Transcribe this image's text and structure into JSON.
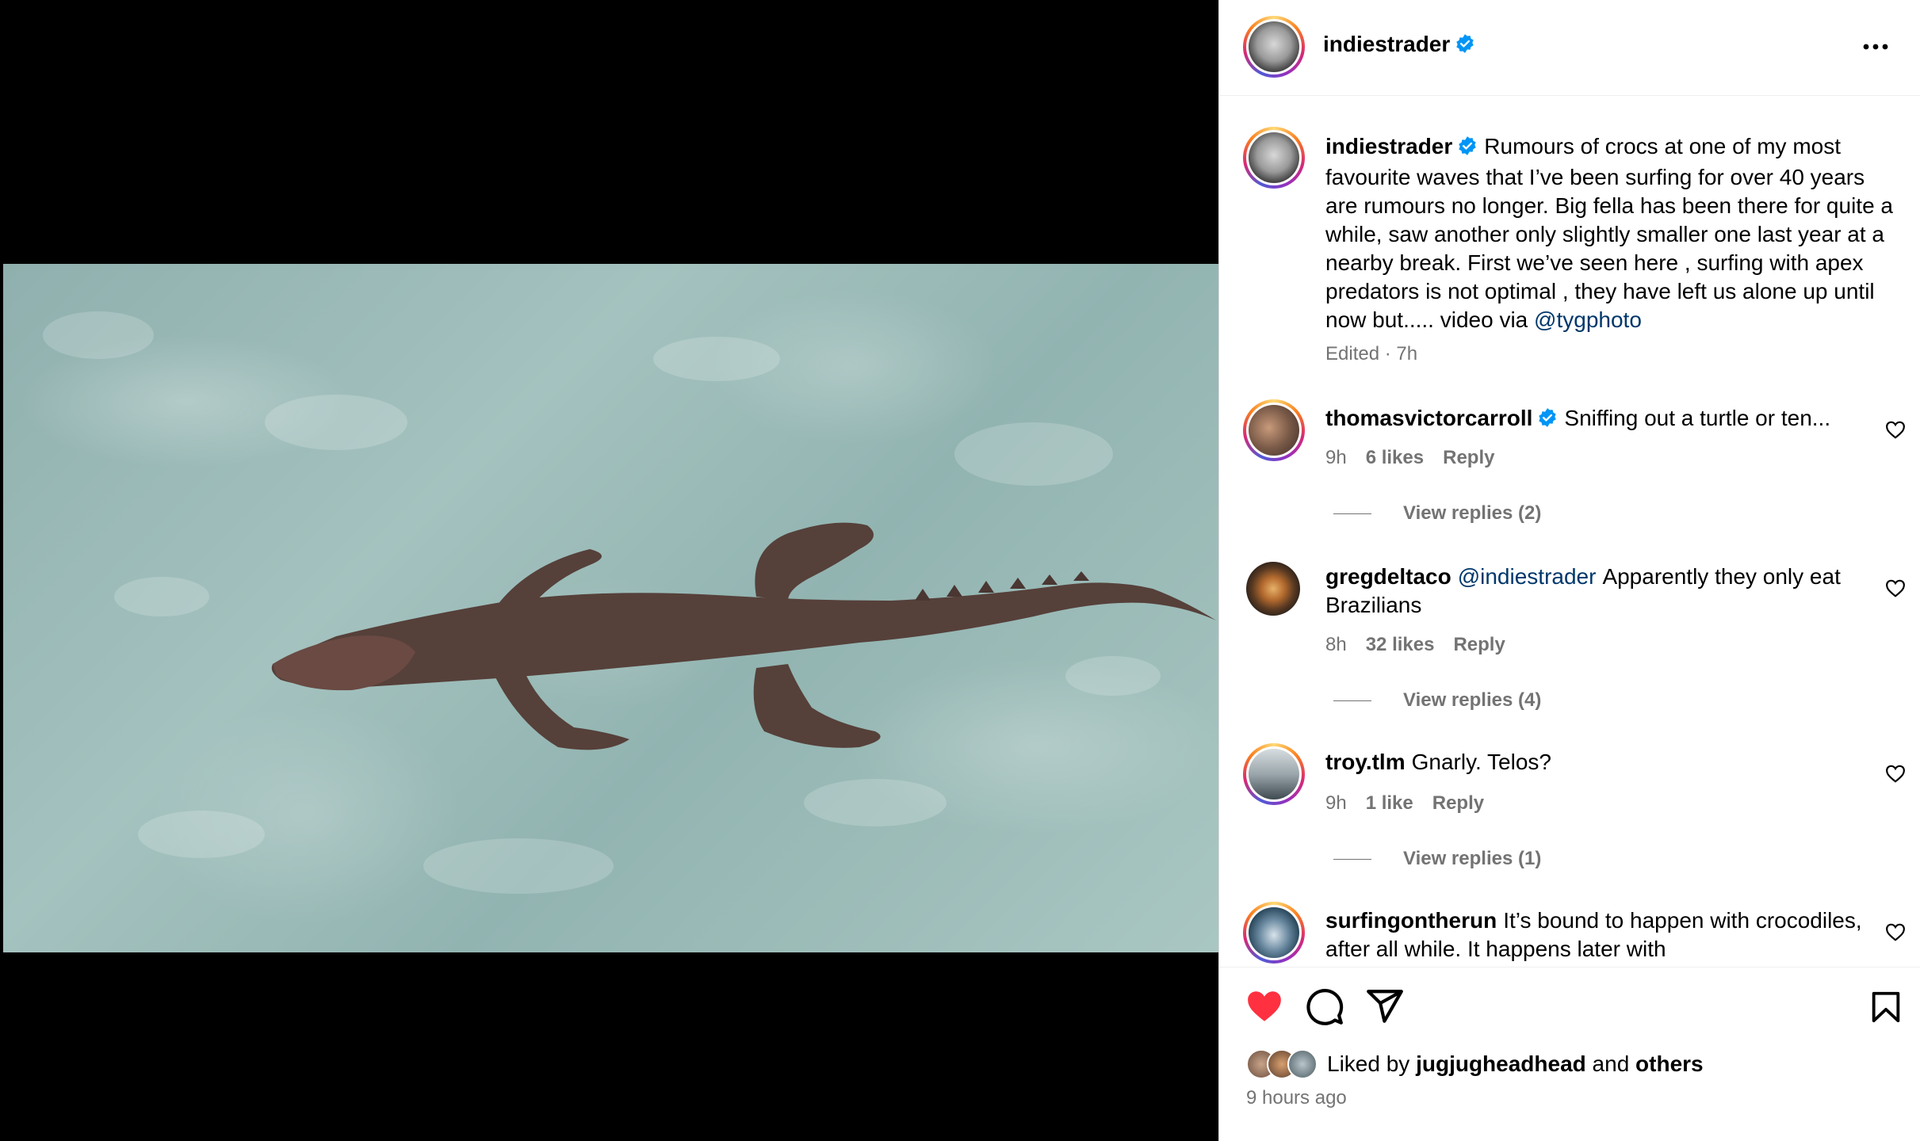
{
  "post": {
    "author": "indiestrader",
    "caption": "Rumours of crocs at one of my most favourite waves that I’ve been surfing for over 40 years are rumours no longer. Big fella has been there for quite a while, saw another only slightly smaller one last year at a nearby break. First we’ve seen here , surfing with apex predators is not optimal , they have left us alone up until now but..... video via",
    "caption_mention": "@tygphoto",
    "edited_meta": "Edited · 7h",
    "verified_icon": "verified-badge-icon",
    "accent_color": "#0095f6"
  },
  "comments": [
    {
      "user": "thomasvictorcarroll",
      "verified": true,
      "text": "Sniffing out a turtle or ten...",
      "mention": "",
      "time": "9h",
      "likes": "6 likes",
      "reply": "Reply",
      "view_replies": "View replies (2)"
    },
    {
      "user": "gregdeltaco",
      "verified": false,
      "mention": "@indiestrader",
      "text": "Apparently they only eat Brazilians",
      "time": "8h",
      "likes": "32 likes",
      "reply": "Reply",
      "view_replies": "View replies (4)"
    },
    {
      "user": "troy.tlm",
      "verified": false,
      "text": "Gnarly. Telos?",
      "mention": "",
      "time": "9h",
      "likes": "1 like",
      "reply": "Reply",
      "view_replies": "View replies (1)"
    },
    {
      "user": "surfingontherun",
      "verified": false,
      "text": "It’s bound to happen with crocodiles, after all while. It happens later with",
      "mention": ""
    }
  ],
  "actions": {
    "liked_by_prefix": "Liked by",
    "liked_by_user": "jugjugheadhead",
    "liked_by_and": "and",
    "liked_by_others": "others",
    "time_ago": "9 hours ago",
    "like_color": "#ff3040"
  }
}
